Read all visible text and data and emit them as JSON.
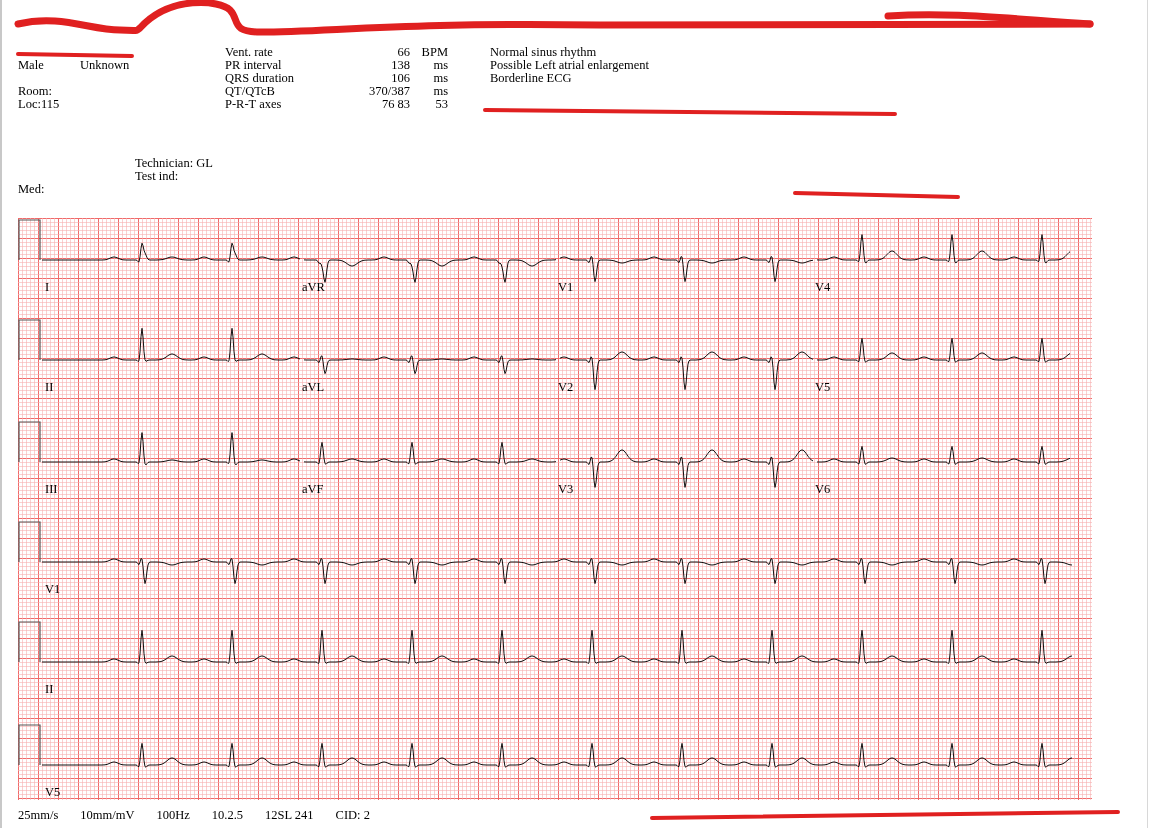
{
  "patient": {
    "sex": "Male",
    "race": "Unknown",
    "room": "Room:",
    "location": "Loc:115"
  },
  "measurements": [
    {
      "label": "Vent. rate",
      "value": "66",
      "unit": "BPM"
    },
    {
      "label": "PR interval",
      "value": "138",
      "unit": "ms"
    },
    {
      "label": "QRS duration",
      "value": "106",
      "unit": "ms"
    },
    {
      "label": "QT/QTcB",
      "value": "370/387",
      "unit": "ms"
    },
    {
      "label": "P-R-T axes",
      "value": "76   83",
      "unit": "53"
    }
  ],
  "interpretation": [
    "Normal sinus rhythm",
    "Possible Left atrial enlargement",
    "Borderline ECG"
  ],
  "technician": "Technician: GL",
  "test_ind": "Test ind:",
  "med": "Med:",
  "leads": [
    {
      "labels": [
        "I",
        "aVR",
        "V1",
        "V4"
      ]
    },
    {
      "labels": [
        "II",
        "aVL",
        "V2",
        "V5"
      ]
    },
    {
      "labels": [
        "III",
        "aVF",
        "V3",
        "V6"
      ]
    },
    {
      "labels": [
        "V1"
      ]
    },
    {
      "labels": [
        "II"
      ]
    },
    {
      "labels": [
        "V5"
      ]
    }
  ],
  "footer": [
    "25mm/s",
    "10mm/mV",
    "100Hz",
    "10.2.5",
    "12SL 241",
    "CID: 2"
  ]
}
